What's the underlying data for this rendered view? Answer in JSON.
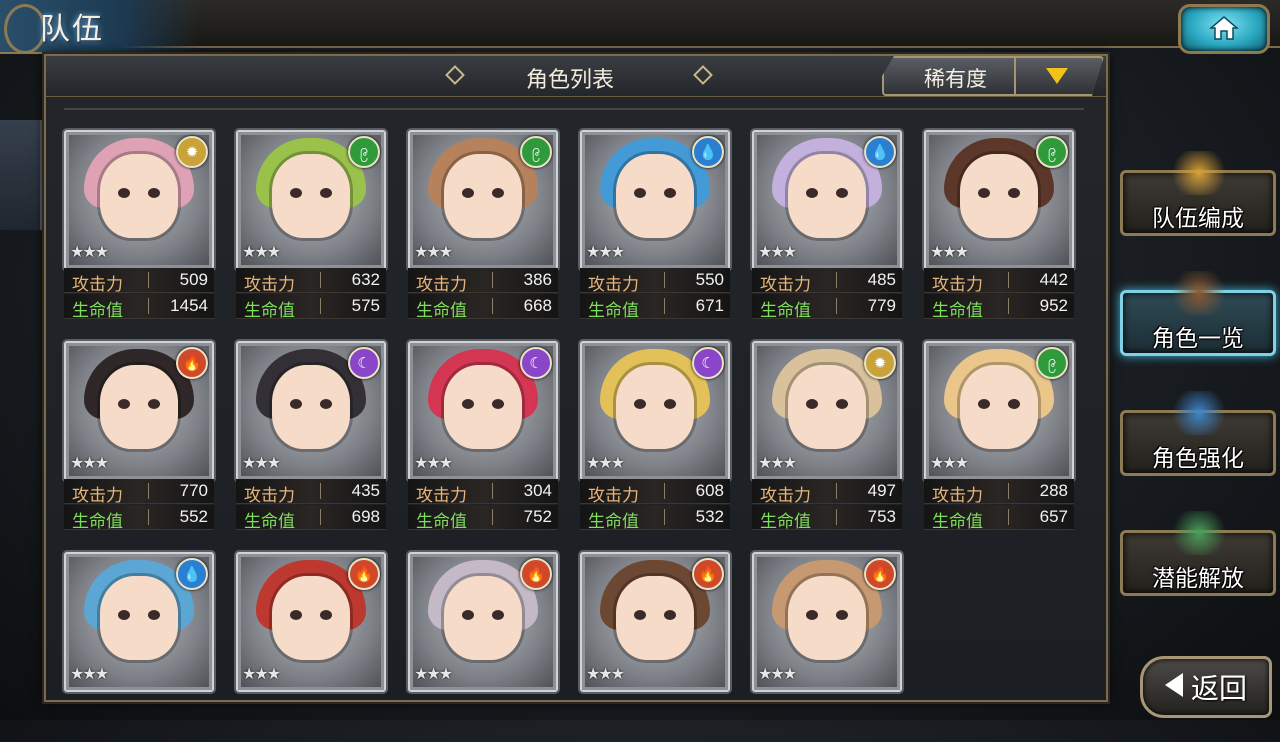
{
  "header": {
    "title": "队伍"
  },
  "panel": {
    "title": "角色列表",
    "sort_label": "稀有度"
  },
  "stat_labels": {
    "attack": "攻击力",
    "hp": "生命值"
  },
  "elements": {
    "light": {
      "glyph": "✹",
      "color": "#caa23a"
    },
    "wind": {
      "glyph": "၉",
      "color": "#2f9a3a"
    },
    "water": {
      "glyph": "💧",
      "color": "#2a7fd0"
    },
    "fire": {
      "glyph": "🔥",
      "color": "#d0482a"
    },
    "dark": {
      "glyph": "☾",
      "color": "#8a46c8"
    }
  },
  "characters": [
    {
      "element": "light",
      "stars": "★★★",
      "attack": "509",
      "hp": "1454",
      "hair": "#e4a3b6"
    },
    {
      "element": "wind",
      "stars": "★★★",
      "attack": "632",
      "hp": "575",
      "hair": "#9bc447"
    },
    {
      "element": "wind",
      "stars": "★★★",
      "attack": "386",
      "hp": "668",
      "hair": "#b8825a"
    },
    {
      "element": "water",
      "stars": "★★★",
      "attack": "550",
      "hp": "671",
      "hair": "#3f9bd9"
    },
    {
      "element": "water",
      "stars": "★★★",
      "attack": "485",
      "hp": "779",
      "hair": "#c6b2e0"
    },
    {
      "element": "wind",
      "stars": "★★★",
      "attack": "442",
      "hp": "952",
      "hair": "#5a3324"
    },
    {
      "element": "fire",
      "stars": "★★★",
      "attack": "770",
      "hp": "552",
      "hair": "#2a2222"
    },
    {
      "element": "dark",
      "stars": "★★★",
      "attack": "435",
      "hp": "698",
      "hair": "#2e2a30"
    },
    {
      "element": "dark",
      "stars": "★★★",
      "attack": "304",
      "hp": "752",
      "hair": "#d8324f"
    },
    {
      "element": "dark",
      "stars": "★★★",
      "attack": "608",
      "hp": "532",
      "hair": "#e8c455"
    },
    {
      "element": "light",
      "stars": "★★★",
      "attack": "497",
      "hp": "753",
      "hair": "#ddc49c"
    },
    {
      "element": "wind",
      "stars": "★★★",
      "attack": "288",
      "hp": "657",
      "hair": "#f0c98a"
    },
    {
      "element": "water",
      "stars": "★★★",
      "attack": null,
      "hp": null,
      "hair": "#5aa8d8"
    },
    {
      "element": "fire",
      "stars": "★★★",
      "attack": null,
      "hp": null,
      "hair": "#c0342a"
    },
    {
      "element": "fire",
      "stars": "★★★",
      "attack": null,
      "hp": null,
      "hair": "#c7bcc8"
    },
    {
      "element": "fire",
      "stars": "★★★",
      "attack": null,
      "hp": null,
      "hair": "#6a452e"
    },
    {
      "element": "fire",
      "stars": "★★★",
      "attack": null,
      "hp": null,
      "hair": "#c99a70"
    }
  ],
  "menu": [
    {
      "label": "队伍编成",
      "art": "#d9a23a",
      "active": false
    },
    {
      "label": "角色一览",
      "art": "#8a5a32",
      "active": true
    },
    {
      "label": "角色强化",
      "art": "#3f86c9",
      "active": false
    },
    {
      "label": "潜能解放",
      "art": "#4aa05a",
      "active": false
    }
  ],
  "back": {
    "label": "返回"
  }
}
